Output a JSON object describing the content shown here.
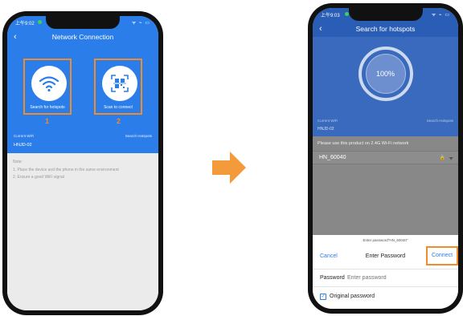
{
  "phone1": {
    "status_time": "上午9:02",
    "status_icons": "ᯤ ⌁ ▭",
    "nav_title": "Network Connection",
    "back_icon": "‹",
    "tiles": [
      {
        "caption": "Search for hotspots",
        "number": "1",
        "icon": "wifi-icon"
      },
      {
        "caption": "Scan to connect",
        "number": "2",
        "icon": "qr-code-icon"
      }
    ],
    "current_wifi_label": "Current WiFi",
    "search_hotspots_label": "Search Hotspots",
    "ssid": "HNJD-02",
    "note_title": "Note:",
    "notes": [
      "1. Place the device and the phone in the same environment",
      "2. Ensure a good WiFi signal"
    ]
  },
  "phone2": {
    "status_time": "上午9:03",
    "status_icons": "ᯤ ⌁ ▭",
    "nav_title": "Search for hotspots",
    "back_icon": "‹",
    "progress_text": "100%",
    "progress": 1.0,
    "current_wifi_label": "Current WiFi",
    "search_hotspots_label": "Search Hotspots",
    "ssid": "HNJD-02",
    "warning": "Please use this product on 2.4G Wi-Fi network",
    "network": {
      "name": "HN_60040",
      "lock": "🔒",
      "wifi": "ᯤ"
    },
    "dialog": {
      "hint": "Enter password\"HN_60040\"",
      "cancel": "Cancel",
      "title": "Enter Password",
      "connect": "Connect",
      "password_label": "Password",
      "password_placeholder": "Enter password",
      "checkbox_mark": "✓",
      "original_password": "Original password"
    }
  },
  "colors": {
    "blue": "#2b7de9",
    "dark_blue": "#2a5db5",
    "highlight": "#f08c2a"
  }
}
